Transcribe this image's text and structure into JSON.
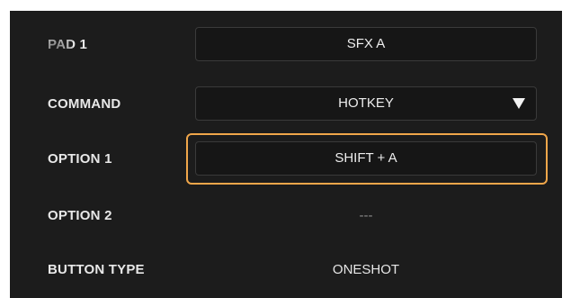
{
  "rows": {
    "pad": {
      "label": "PAD 1",
      "value": "SFX A"
    },
    "command": {
      "label": "COMMAND",
      "value": "HOTKEY"
    },
    "option1": {
      "label": "OPTION 1",
      "value": "SHIFT + A"
    },
    "option2": {
      "label": "OPTION 2",
      "value": "---"
    },
    "button_type": {
      "label": "BUTTON TYPE",
      "value": "ONESHOT"
    }
  },
  "colors": {
    "panel_background": "#1c1c1c",
    "highlight_border": "#f0a64a",
    "field_border": "#3a3a3a"
  },
  "icons": {
    "dropdown": "chevron-down-icon"
  }
}
